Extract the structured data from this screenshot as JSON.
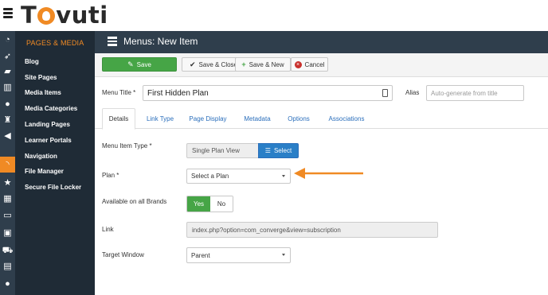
{
  "app": {
    "logo": "Tovuti"
  },
  "rail": {
    "icons": [
      "dashboard-icon",
      "rocket-icon",
      "graduation-cap-icon",
      "bar-chart-icon",
      "user-icon",
      "trophy-icon",
      "bullhorn-icon",
      "rss-icon",
      "star-icon",
      "table-icon",
      "credit-card-icon",
      "id-card-icon",
      "cart-icon",
      "clipboard-icon",
      "calculator-icon",
      "comments-icon"
    ]
  },
  "sidebar": {
    "section_title": "PAGES & MEDIA",
    "items": [
      "Blog",
      "Site Pages",
      "Media Items",
      "Media Categories",
      "Landing Pages",
      "Learner Portals",
      "Navigation",
      "File Manager",
      "Secure File Locker"
    ]
  },
  "header": {
    "title": "Menus: New Item"
  },
  "toolbar": {
    "save": "Save",
    "save_close": "Save & Close",
    "save_new": "Save & New",
    "cancel": "Cancel"
  },
  "form": {
    "menu_title_label": "Menu Title *",
    "menu_title_value": "First Hidden Plan",
    "alias_label": "Alias",
    "alias_placeholder": "Auto-generate from title"
  },
  "tabs": [
    "Details",
    "Link Type",
    "Page Display",
    "Metadata",
    "Options",
    "Associations"
  ],
  "details": {
    "menu_item_type_label": "Menu Item Type *",
    "menu_item_type_value": "Single Plan View",
    "select_button": "Select",
    "plan_label": "Plan *",
    "plan_value": "Select a Plan",
    "brands_label": "Available on all Brands",
    "yes": "Yes",
    "no": "No",
    "link_label": "Link",
    "link_value": "index.php?option=com_converge&view=subscription",
    "target_label": "Target Window",
    "target_value": "Parent"
  },
  "colors": {
    "accent": "#f08a24",
    "sidebar": "#1f2b36",
    "header": "#2f3e4c",
    "success": "#46a546",
    "link": "#2a6ebb"
  }
}
